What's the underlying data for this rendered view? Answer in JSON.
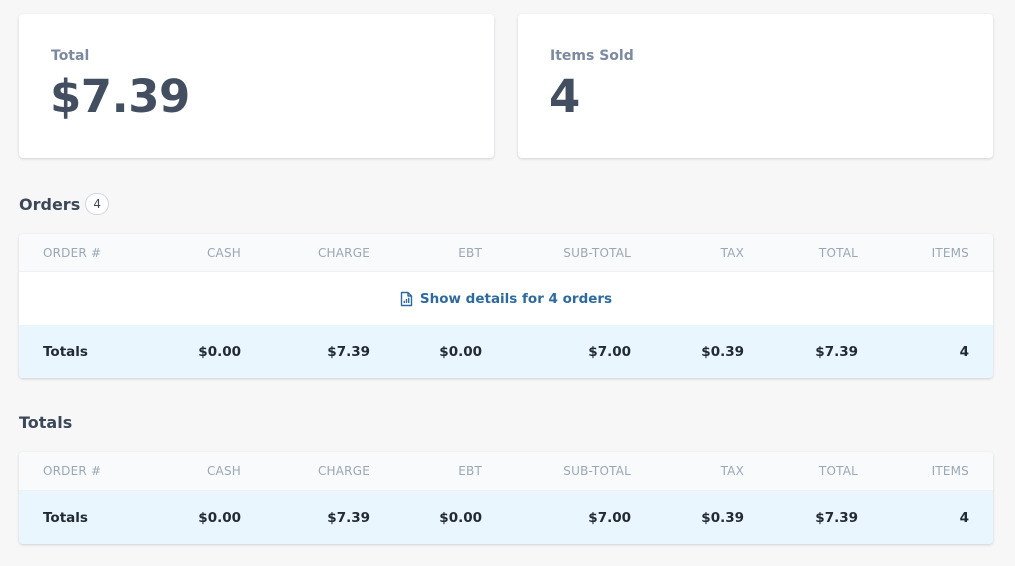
{
  "summary": {
    "total_label": "Total",
    "total_value": "$7.39",
    "items_label": "Items Sold",
    "items_value": "4"
  },
  "orders": {
    "title": "Orders",
    "count": "4",
    "columns": [
      "ORDER #",
      "CASH",
      "CHARGE",
      "EBT",
      "SUB-TOTAL",
      "TAX",
      "TOTAL",
      "ITEMS"
    ],
    "details_link": "Show details for 4 orders",
    "details_icon": "report-document-icon",
    "totals_row": [
      "Totals",
      "$0.00",
      "$7.39",
      "$0.00",
      "$7.00",
      "$0.39",
      "$7.39",
      "4"
    ]
  },
  "totals": {
    "title": "Totals",
    "columns": [
      "ORDER #",
      "CASH",
      "CHARGE",
      "EBT",
      "SUB-TOTAL",
      "TAX",
      "TOTAL",
      "ITEMS"
    ],
    "totals_row": [
      "Totals",
      "$0.00",
      "$7.39",
      "$0.00",
      "$7.00",
      "$0.39",
      "$7.39",
      "4"
    ]
  },
  "colors": {
    "background": "#f7f7f8",
    "totals_row_bg": "#eaf6fd",
    "link": "#2d6a9f",
    "header_text": "#9aa7b8"
  }
}
